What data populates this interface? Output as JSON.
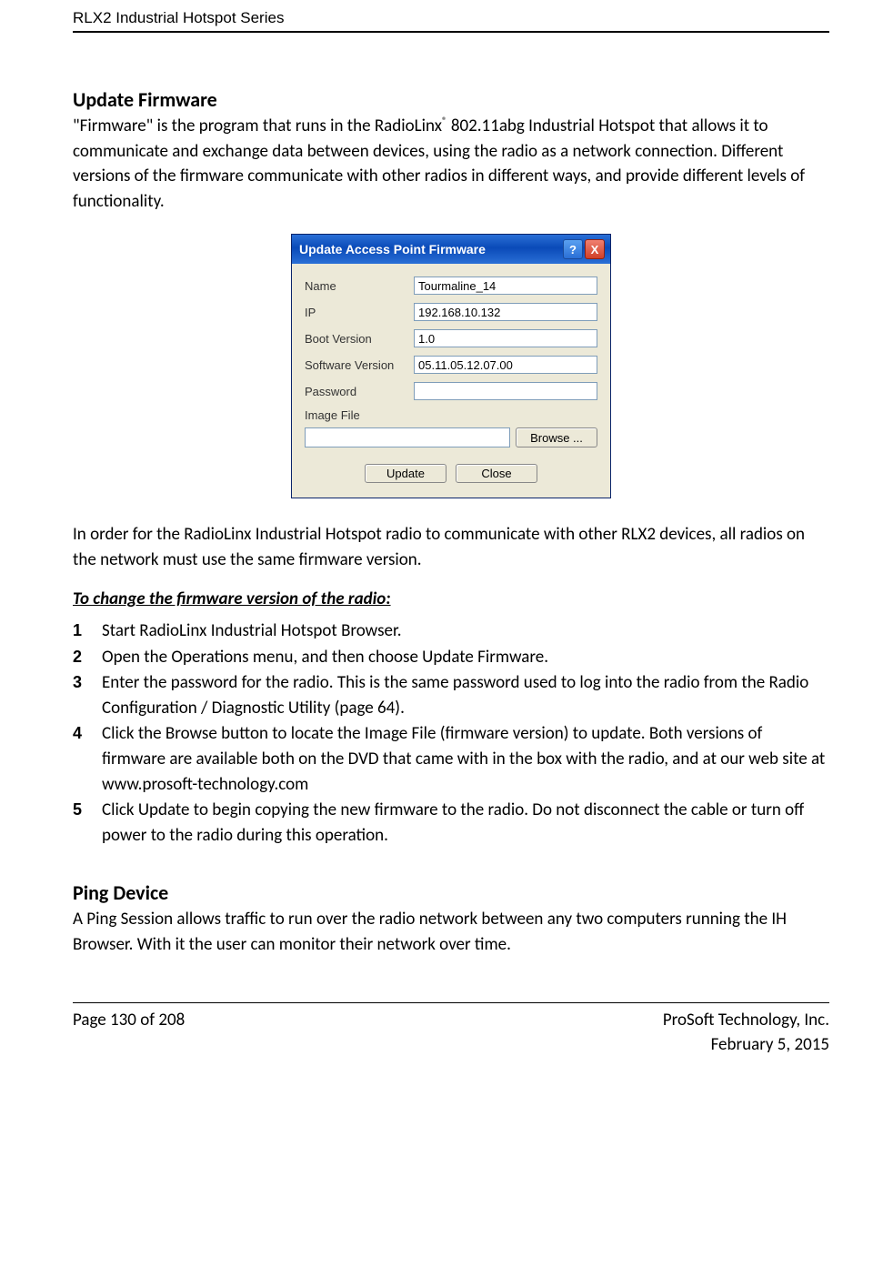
{
  "header": {
    "series": "RLX2 Industrial Hotspot Series"
  },
  "section1": {
    "title": "Update Firmware",
    "para1_a": "\"Firmware\" is the program that runs in the RadioLinx",
    "reg": "®",
    "para1_b": " 802.11abg Industrial Hotspot that allows it to communicate and exchange data between devices, using the radio as a network connection. Different versions of the firmware communicate with other radios in different ways, and provide different levels of functionality.",
    "para2": "In order for the RadioLinx Industrial Hotspot radio to communicate with other RLX2 devices, all radios on the network must use the same firmware version.",
    "subheading": "To change the firmware version of the radio:",
    "steps": [
      "Start RadioLinx Industrial Hotspot Browser.",
      "Open the Operations menu, and then choose Update Firmware.",
      "Enter the password for the radio. This is the same password used to log into the radio from the Radio Configuration / Diagnostic Utility (page 64).",
      "Click the Browse button to locate the Image File (firmware version) to update. Both versions of firmware are available both on the DVD that came with in the box with the radio, and at our web site at www.prosoft-technology.com",
      "Click Update to begin copying the new firmware to the radio. Do not disconnect the cable or turn off power to the radio during this operation."
    ],
    "step_nums": [
      "1",
      "2",
      "3",
      "4",
      "5"
    ]
  },
  "dialog": {
    "title": "Update Access Point Firmware",
    "help_glyph": "?",
    "close_glyph": "X",
    "labels": {
      "name": "Name",
      "ip": "IP",
      "boot": "Boot Version",
      "software": "Software Version",
      "password": "Password",
      "imagefile": "Image File"
    },
    "values": {
      "name": "Tourmaline_14",
      "ip": "192.168.10.132",
      "boot": "1.0",
      "software": "05.11.05.12.07.00",
      "password": "",
      "imagefile": ""
    },
    "buttons": {
      "browse": "Browse ...",
      "update": "Update",
      "close": "Close"
    }
  },
  "section2": {
    "title": "Ping Device",
    "para": "A Ping Session allows traffic to run over the radio network between any two computers running the IH Browser. With it the user can monitor their network over time."
  },
  "footer": {
    "page": "Page 130 of 208",
    "company": "ProSoft Technology, Inc.",
    "date": "February 5, 2015"
  }
}
